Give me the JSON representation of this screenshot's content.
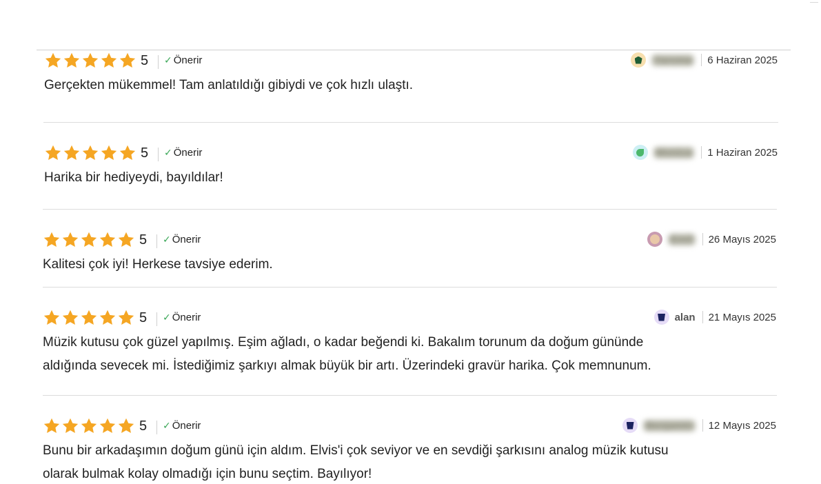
{
  "colors": {
    "star": "#f5a623",
    "check": "#3aa757",
    "divider": "#dcdcdc"
  },
  "reviews": [
    {
      "rating": "5",
      "recommend_label": "Önerir",
      "reviewer_name": "Yaroma",
      "reviewer_name_blurred": true,
      "avatar_color": "#f7dfae",
      "avatar_inner_color": "#1f5e35",
      "date": "6 Haziran 2025",
      "text": "Gerçekten mükemmel! Tam anlatıldığı gibiydi ve çok hızlı ulaştı."
    },
    {
      "rating": "5",
      "recommend_label": "Önerir",
      "reviewer_name": "Monica",
      "reviewer_name_blurred": true,
      "avatar_color": "#cdeff4",
      "avatar_inner_color": "#4cb86c",
      "date": "1 Haziran 2025",
      "text": "Harika bir hediyeydi, bayıldılar!"
    },
    {
      "rating": "5",
      "recommend_label": "Önerir",
      "reviewer_name": "Emil",
      "reviewer_name_blurred": true,
      "avatar_color": "#c89bb0",
      "avatar_inner_color": "#e9c8a8",
      "date": "26 Mayıs 2025",
      "text": "Kalitesi çok iyi! Herkese tavsiye ederim."
    },
    {
      "rating": "5",
      "recommend_label": "Önerir",
      "reviewer_name": "alan",
      "reviewer_name_blurred": false,
      "avatar_color": "#e6dcf7",
      "avatar_inner_color": "#1c2360",
      "date": "21 Mayıs 2025",
      "text_lines": [
        "Müzik kutusu çok güzel yapılmış. Eşim ağladı, o kadar beğendi ki. Bakalım torunum da doğum gününde",
        "aldığında sevecek mi. İstediğimiz şarkıyı almak büyük bir artı. Üzerindeki gravür harika. Çok memnunum."
      ]
    },
    {
      "rating": "5",
      "recommend_label": "Önerir",
      "reviewer_name": "Benjamin",
      "reviewer_name_blurred": true,
      "avatar_color": "#e6dcf7",
      "avatar_inner_color": "#1c2360",
      "date": "12 Mayıs 2025",
      "text_lines": [
        "Bunu bir arkadaşımın doğum günü için aldım. Elvis'i çok seviyor ve en sevdiği şarkısını analog müzik kutusu",
        "olarak bulmak kolay olmadığı için bunu seçtim. Bayılıyor!"
      ]
    }
  ]
}
